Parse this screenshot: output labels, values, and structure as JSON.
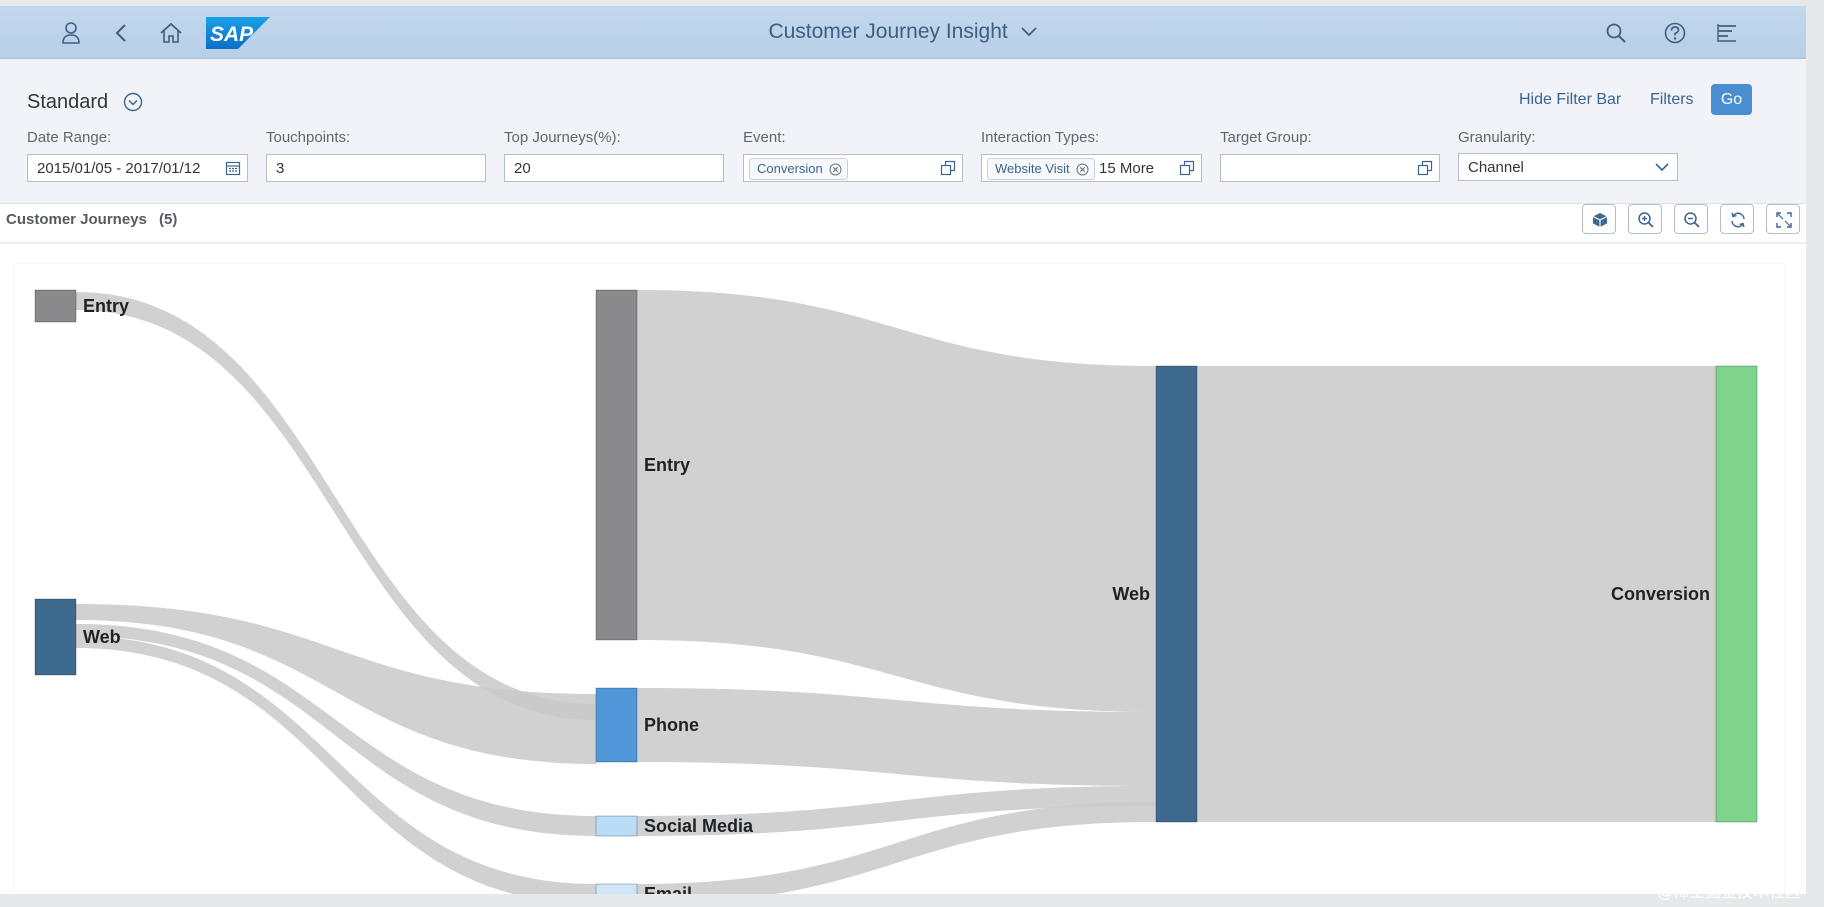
{
  "shellbar": {
    "title": "Customer Journey Insight",
    "logo_text": "SAP",
    "icons": [
      "user-icon",
      "back-icon",
      "home-icon",
      "search-icon",
      "help-icon",
      "notifications-icon"
    ]
  },
  "filter_bar": {
    "variant": "Standard",
    "hide_filter_bar": "Hide Filter Bar",
    "filters": "Filters",
    "go": "Go",
    "fields": {
      "date_range": {
        "label": "Date Range:",
        "value": "2015/01/05 - 2017/01/12"
      },
      "touchpoints": {
        "label": "Touchpoints:",
        "value": "3"
      },
      "top_journeys": {
        "label": "Top Journeys(%):",
        "value": "20"
      },
      "event": {
        "label": "Event:",
        "token": "Conversion"
      },
      "interaction_types": {
        "label": "Interaction Types:",
        "token": "Website Visit",
        "more": "15 More"
      },
      "target_group": {
        "label": "Target Group:",
        "value": ""
      },
      "granularity": {
        "label": "Granularity:",
        "value": "Channel"
      }
    }
  },
  "content": {
    "title": "Customer Journeys",
    "count": "(5)"
  },
  "colors": {
    "entry": "#8a898b",
    "web": "#3e6a90",
    "phone": "#4f97d8",
    "social": "#b9dcf7",
    "email": "#cfe6f8",
    "conversion": "#7ed48a",
    "link": "#c9c9c9"
  },
  "chart_data": {
    "type": "sankey",
    "nodes": [
      {
        "id": "s1_entry",
        "label": "Entry",
        "stage": 1,
        "color": "entry"
      },
      {
        "id": "s1_web",
        "label": "Web",
        "stage": 1,
        "color": "web"
      },
      {
        "id": "s2_entry",
        "label": "Entry",
        "stage": 2,
        "color": "entry"
      },
      {
        "id": "s2_phone",
        "label": "Phone",
        "stage": 2,
        "color": "phone"
      },
      {
        "id": "s2_social",
        "label": "Social Media",
        "stage": 2,
        "color": "social"
      },
      {
        "id": "s2_email",
        "label": "Email",
        "stage": 2,
        "color": "email"
      },
      {
        "id": "s3_web",
        "label": "Web",
        "stage": 3,
        "color": "web"
      },
      {
        "id": "s4_conv",
        "label": "Conversion",
        "stage": 4,
        "color": "conversion"
      }
    ],
    "links": [
      {
        "source": "s1_entry",
        "target": "s2_phone",
        "value": 0.4
      },
      {
        "source": "s1_web",
        "target": "s2_phone",
        "value": 0.35
      },
      {
        "source": "s1_web",
        "target": "s2_social",
        "value": 0.22
      },
      {
        "source": "s1_web",
        "target": "s2_email",
        "value": 0.2
      },
      {
        "source": "s2_entry",
        "target": "s3_web",
        "value": 3.5
      },
      {
        "source": "s2_phone",
        "target": "s3_web",
        "value": 0.75
      },
      {
        "source": "s2_social",
        "target": "s3_web",
        "value": 0.22
      },
      {
        "source": "s2_email",
        "target": "s3_web",
        "value": 0.2
      },
      {
        "source": "s3_web",
        "target": "s4_conv",
        "value": 4.67
      }
    ]
  }
}
